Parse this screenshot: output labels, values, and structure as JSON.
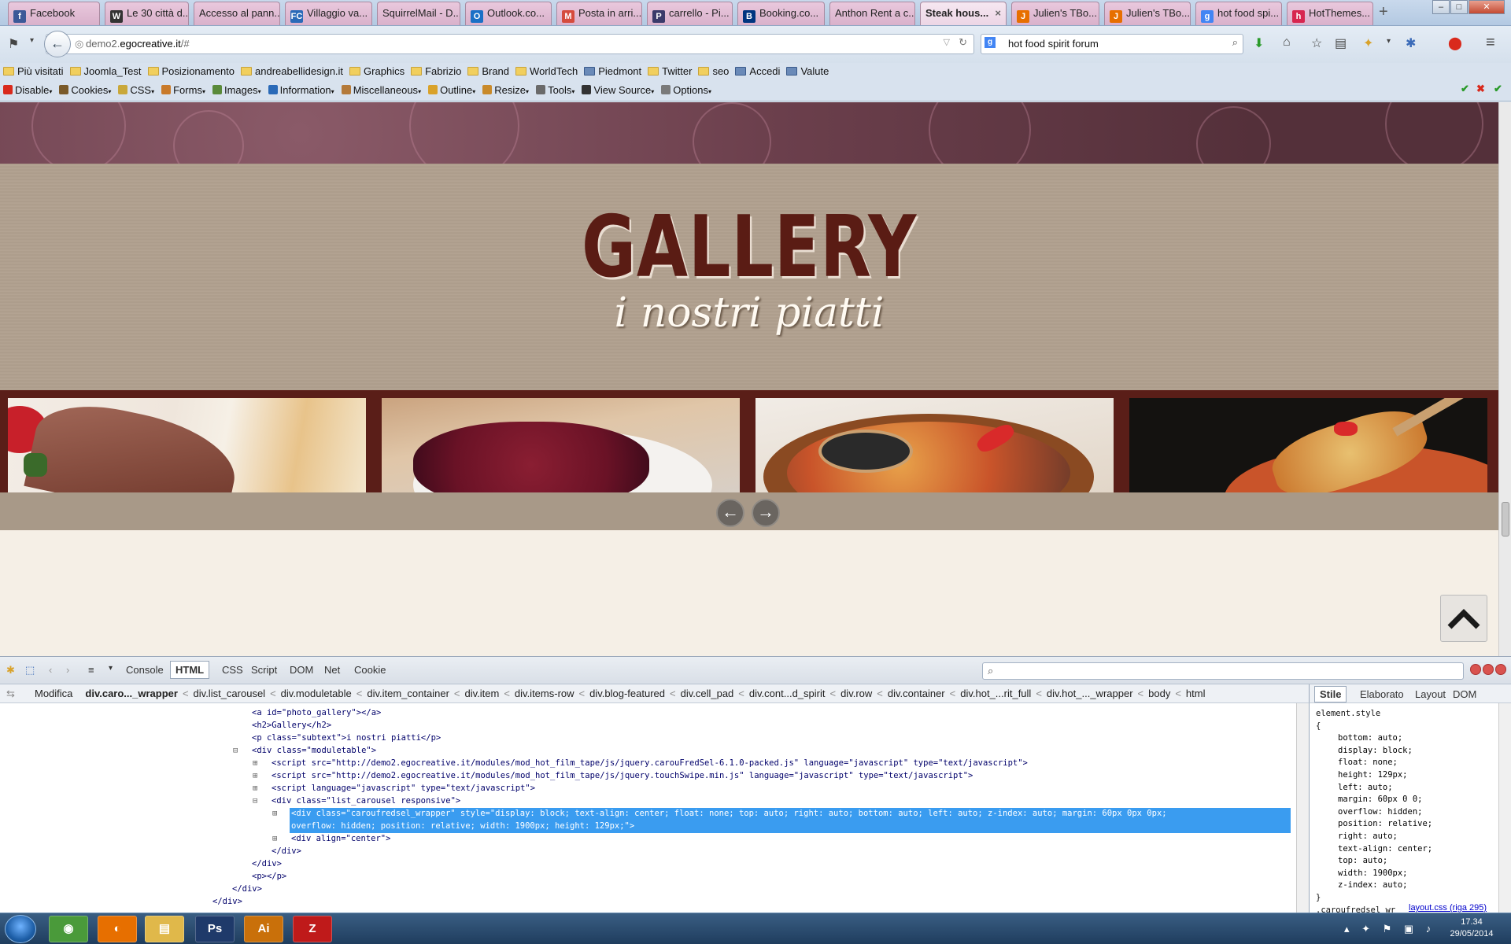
{
  "tabs": [
    {
      "label": "Facebook",
      "icon": "facebook-icon",
      "icon_color": "#3b5998",
      "glyph": "f"
    },
    {
      "label": "Le 30 città d...",
      "icon": "wikipedia-icon",
      "icon_color": "#333333",
      "glyph": "W"
    },
    {
      "label": "Accesso al pann...",
      "icon": "none",
      "icon_color": "",
      "glyph": ""
    },
    {
      "label": "Villaggio va...",
      "icon": "fc-icon",
      "icon_color": "#2a6ab8",
      "glyph": "FC"
    },
    {
      "label": "SquirrelMail - D...",
      "icon": "none",
      "icon_color": "",
      "glyph": ""
    },
    {
      "label": "Outlook.co...",
      "icon": "outlook-icon",
      "icon_color": "#1a70c6",
      "glyph": "O"
    },
    {
      "label": "Posta in arri...",
      "icon": "gmail-icon",
      "icon_color": "#d54b3d",
      "glyph": "M"
    },
    {
      "label": "carrello - Pi...",
      "icon": "p-icon",
      "icon_color": "#3a3a6a",
      "glyph": "P"
    },
    {
      "label": "Booking.co...",
      "icon": "booking-icon",
      "icon_color": "#003580",
      "glyph": "B"
    },
    {
      "label": "Anthon Rent a c...",
      "icon": "none",
      "icon_color": "",
      "glyph": ""
    },
    {
      "label": "Steak hous...",
      "icon": "none",
      "icon_color": "",
      "glyph": "",
      "active": true,
      "close": "×"
    },
    {
      "label": "Julien's TBo...",
      "icon": "joomla-icon",
      "icon_color": "#e76f00",
      "glyph": "J"
    },
    {
      "label": "Julien's TBo...",
      "icon": "joomla-icon",
      "icon_color": "#e76f00",
      "glyph": "J"
    },
    {
      "label": "hot food spi...",
      "icon": "google-icon",
      "icon_color": "#4285f4",
      "glyph": "g"
    },
    {
      "label": "HotThemes...",
      "icon": "hotthemes-icon",
      "icon_color": "#d7264f",
      "glyph": "h"
    }
  ],
  "new_tab": "+",
  "window_controls": {
    "minimize": "–",
    "maximize": "□",
    "close": "✕"
  },
  "nav": {
    "url_prefix": "demo2.",
    "url_domain": "egocreative.it",
    "url_suffix": "/#",
    "search_value": "hot food spirit forum"
  },
  "bookmarks": [
    {
      "label": "Più visitati",
      "type": "folder"
    },
    {
      "label": "Joomla_Test",
      "type": "folder"
    },
    {
      "label": "Posizionamento",
      "type": "folder"
    },
    {
      "label": "andreabellidesign.it",
      "type": "folder"
    },
    {
      "label": "Graphics",
      "type": "folder"
    },
    {
      "label": "Fabrizio",
      "type": "folder"
    },
    {
      "label": "Brand",
      "type": "folder"
    },
    {
      "label": "WorldTech",
      "type": "folder"
    },
    {
      "label": "Piedmont",
      "type": "link"
    },
    {
      "label": "Twitter",
      "type": "folder"
    },
    {
      "label": "seo",
      "type": "folder"
    },
    {
      "label": "Accedi",
      "type": "link"
    },
    {
      "label": "Valute",
      "type": "link"
    }
  ],
  "webdev": [
    {
      "label": "Disable",
      "color": "#d9291c"
    },
    {
      "label": "Cookies",
      "color": "#7a5a2a"
    },
    {
      "label": "CSS",
      "color": "#c9a83a"
    },
    {
      "label": "Forms",
      "color": "#c97a2a"
    },
    {
      "label": "Images",
      "color": "#5a8a3a"
    },
    {
      "label": "Information",
      "color": "#2a6ab8"
    },
    {
      "label": "Miscellaneous",
      "color": "#b47a3a"
    },
    {
      "label": "Outline",
      "color": "#d9a22a"
    },
    {
      "label": "Resize",
      "color": "#c98a2a"
    },
    {
      "label": "Tools",
      "color": "#6a6a6a"
    },
    {
      "label": "View Source",
      "color": "#333333"
    },
    {
      "label": "Options",
      "color": "#7a7a7a"
    }
  ],
  "page": {
    "title": "GALLERY",
    "subtitle": "i nostri piatti",
    "prev_arrow": "←",
    "next_arrow": "→",
    "back_to_top": "▲"
  },
  "photos": [
    {
      "name": "photo-dessert",
      "base": "#efe7df",
      "accent": "#8a4a3a"
    },
    {
      "name": "photo-raspberries",
      "base": "#c9a78a",
      "accent": "#8a2a3a"
    },
    {
      "name": "photo-seafood",
      "base": "#e9dfd3",
      "accent": "#b8642a"
    },
    {
      "name": "photo-pizza",
      "base": "#1a1410",
      "accent": "#c9542a"
    }
  ],
  "firebug": {
    "tabs": [
      "Console",
      "HTML",
      "CSS",
      "Script",
      "DOM",
      "Net",
      "Cookie"
    ],
    "selected_tab": "HTML",
    "edit_label": "Modifica",
    "breadcrumb": [
      "div.caro..._wrapper",
      "div.list_carousel",
      "div.moduletable",
      "div.item_container",
      "div.item",
      "div.items-row",
      "div.blog-featured",
      "div.cell_pad",
      "div.cont...d_spirit",
      "div.row",
      "div.container",
      "div.hot_...rit_full",
      "div.hot_..._wrapper",
      "body",
      "html"
    ],
    "side_tabs": [
      "Stile",
      "Elaborato",
      "Layout",
      "DOM"
    ],
    "side_selected": "Stile",
    "html_lines": [
      {
        "indent": 0,
        "text": "<a id=\"photo_gallery\"></a>"
      },
      {
        "indent": 0,
        "text": "<h2>Gallery</h2>"
      },
      {
        "indent": 0,
        "text": "<p class=\"subtext\">i nostri piatti</p>"
      },
      {
        "indent": 0,
        "toggle": "⊟",
        "text": "<div class=\"moduletable\">"
      },
      {
        "indent": 1,
        "toggle": "⊞",
        "text": "<script src=\"http://demo2.egocreative.it/modules/mod_hot_film_tape/js/jquery.carouFredSel-6.1.0-packed.js\" language=\"javascript\" type=\"text/javascript\">"
      },
      {
        "indent": 1,
        "toggle": "⊞",
        "text": "<script src=\"http://demo2.egocreative.it/modules/mod_hot_film_tape/js/jquery.touchSwipe.min.js\" language=\"javascript\" type=\"text/javascript\">"
      },
      {
        "indent": 1,
        "toggle": "⊞",
        "text": "<script language=\"javascript\" type=\"text/javascript\">"
      },
      {
        "indent": 1,
        "toggle": "⊟",
        "text": "<div class=\"list_carousel responsive\">"
      },
      {
        "indent": 2,
        "toggle": "⊞",
        "text": "<div class=\"caroufredsel_wrapper\" style=\"display: block; text-align: center; float: none; top: auto; right: auto; bottom: auto; left: auto; z-index: auto; margin: 60px 0px 0px;",
        "highlight": true
      },
      {
        "indent": 2,
        "text": "overflow: hidden; position: relative; width: 1900px; height: 129px;\">",
        "highlight": true,
        "continuation": true
      },
      {
        "indent": 2,
        "toggle": "⊞",
        "text": "<div align=\"center\">"
      },
      {
        "indent": 1,
        "text": "</div>"
      },
      {
        "indent": 0,
        "text": "</div>"
      },
      {
        "indent": 0,
        "text": "<p></p>"
      },
      {
        "indent": -1,
        "text": "</div>"
      },
      {
        "indent": -2,
        "text": "</div>"
      }
    ],
    "style_selector": "element.style",
    "style_props": [
      "bottom: auto;",
      "display: block;",
      "float: none;",
      "height: 129px;",
      "left: auto;",
      "margin: 60px 0 0;",
      "overflow: hidden;",
      "position: relative;",
      "right: auto;",
      "text-align: center;",
      "top: auto;",
      "width: 1900px;",
      "z-index: auto;"
    ],
    "style_next_rule": ".caroufredsel_wr",
    "css_link": "layout.css (riga 295)"
  },
  "taskbar": {
    "apps": [
      {
        "name": "chrome",
        "glyph": "◉",
        "color": "#4a9a3a"
      },
      {
        "name": "firefox",
        "glyph": "◐",
        "color": "#e76f00"
      },
      {
        "name": "explorer",
        "glyph": "▤",
        "color": "#e0b84a"
      },
      {
        "name": "photoshop",
        "glyph": "Ps",
        "color": "#1f3a6a"
      },
      {
        "name": "illustrator",
        "glyph": "Ai",
        "color": "#c9700a"
      },
      {
        "name": "filezilla",
        "glyph": "Z",
        "color": "#bf1a1a"
      }
    ],
    "time": "17.34",
    "date": "29/05/2014"
  }
}
